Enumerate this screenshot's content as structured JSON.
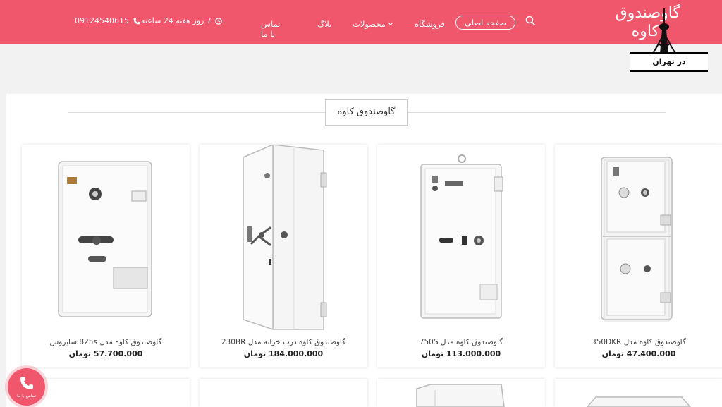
{
  "header": {
    "phone": "09124540615",
    "hours": "7 روز هفته 24 ساعته",
    "nav": {
      "home": "صفحه اصلی",
      "shop": "فروشگاه",
      "products": "محصولات",
      "blog": "بلاگ",
      "contact": "تماس با ما"
    },
    "logo": {
      "line1": "گاوصندوق",
      "line2": "کاوه",
      "tag": "در تهران"
    }
  },
  "section": {
    "title": "گاوصندوق کاوه"
  },
  "products": [
    {
      "name": "گاوصندوق کاوه مدل 350DKR",
      "price": "47.400.000 تومان"
    },
    {
      "name": "گاوصندوق کاوه مدل 750S",
      "price": "113.000.000 تومان"
    },
    {
      "name": "گاوصندوق کاوه درب خزانه مدل 230BR",
      "price": "184.000.000 تومان"
    },
    {
      "name": "گاوصندوق کاوه مدل 825s سایروس",
      "price": "57.700.000 تومان"
    }
  ],
  "call_button": {
    "label": "تماس با ما"
  },
  "colors": {
    "accent": "#f0566c",
    "panel": "#ffffff",
    "background": "#f2f2f2"
  }
}
